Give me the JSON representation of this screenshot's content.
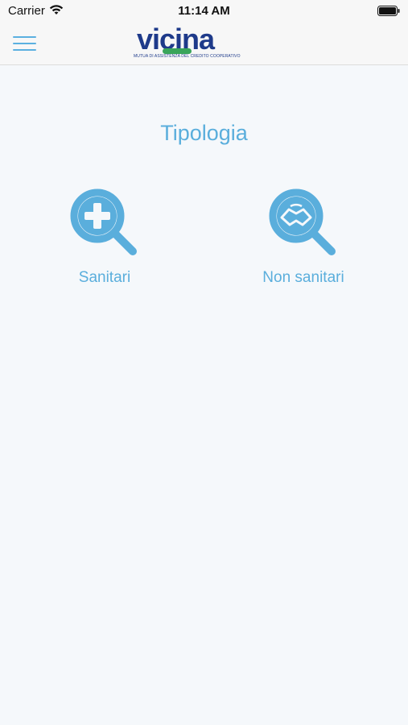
{
  "status_bar": {
    "carrier": "Carrier",
    "time": "11:14 AM"
  },
  "header": {
    "menu_icon": "hamburger-menu-icon",
    "logo_text": "vicina",
    "logo_tagline": "MUTUA DI ASSISTENZA DEL CREDITO COOPERATIVO"
  },
  "main": {
    "title": "Tipologia",
    "options": [
      {
        "label": "Sanitari",
        "icon": "magnifier-plus-icon"
      },
      {
        "label": "Non sanitari",
        "icon": "magnifier-handshake-icon"
      }
    ]
  },
  "colors": {
    "accent": "#5aaedc",
    "logo_blue": "#1e3a8a",
    "logo_green": "#3aa55a",
    "background": "#f5f8fb"
  }
}
